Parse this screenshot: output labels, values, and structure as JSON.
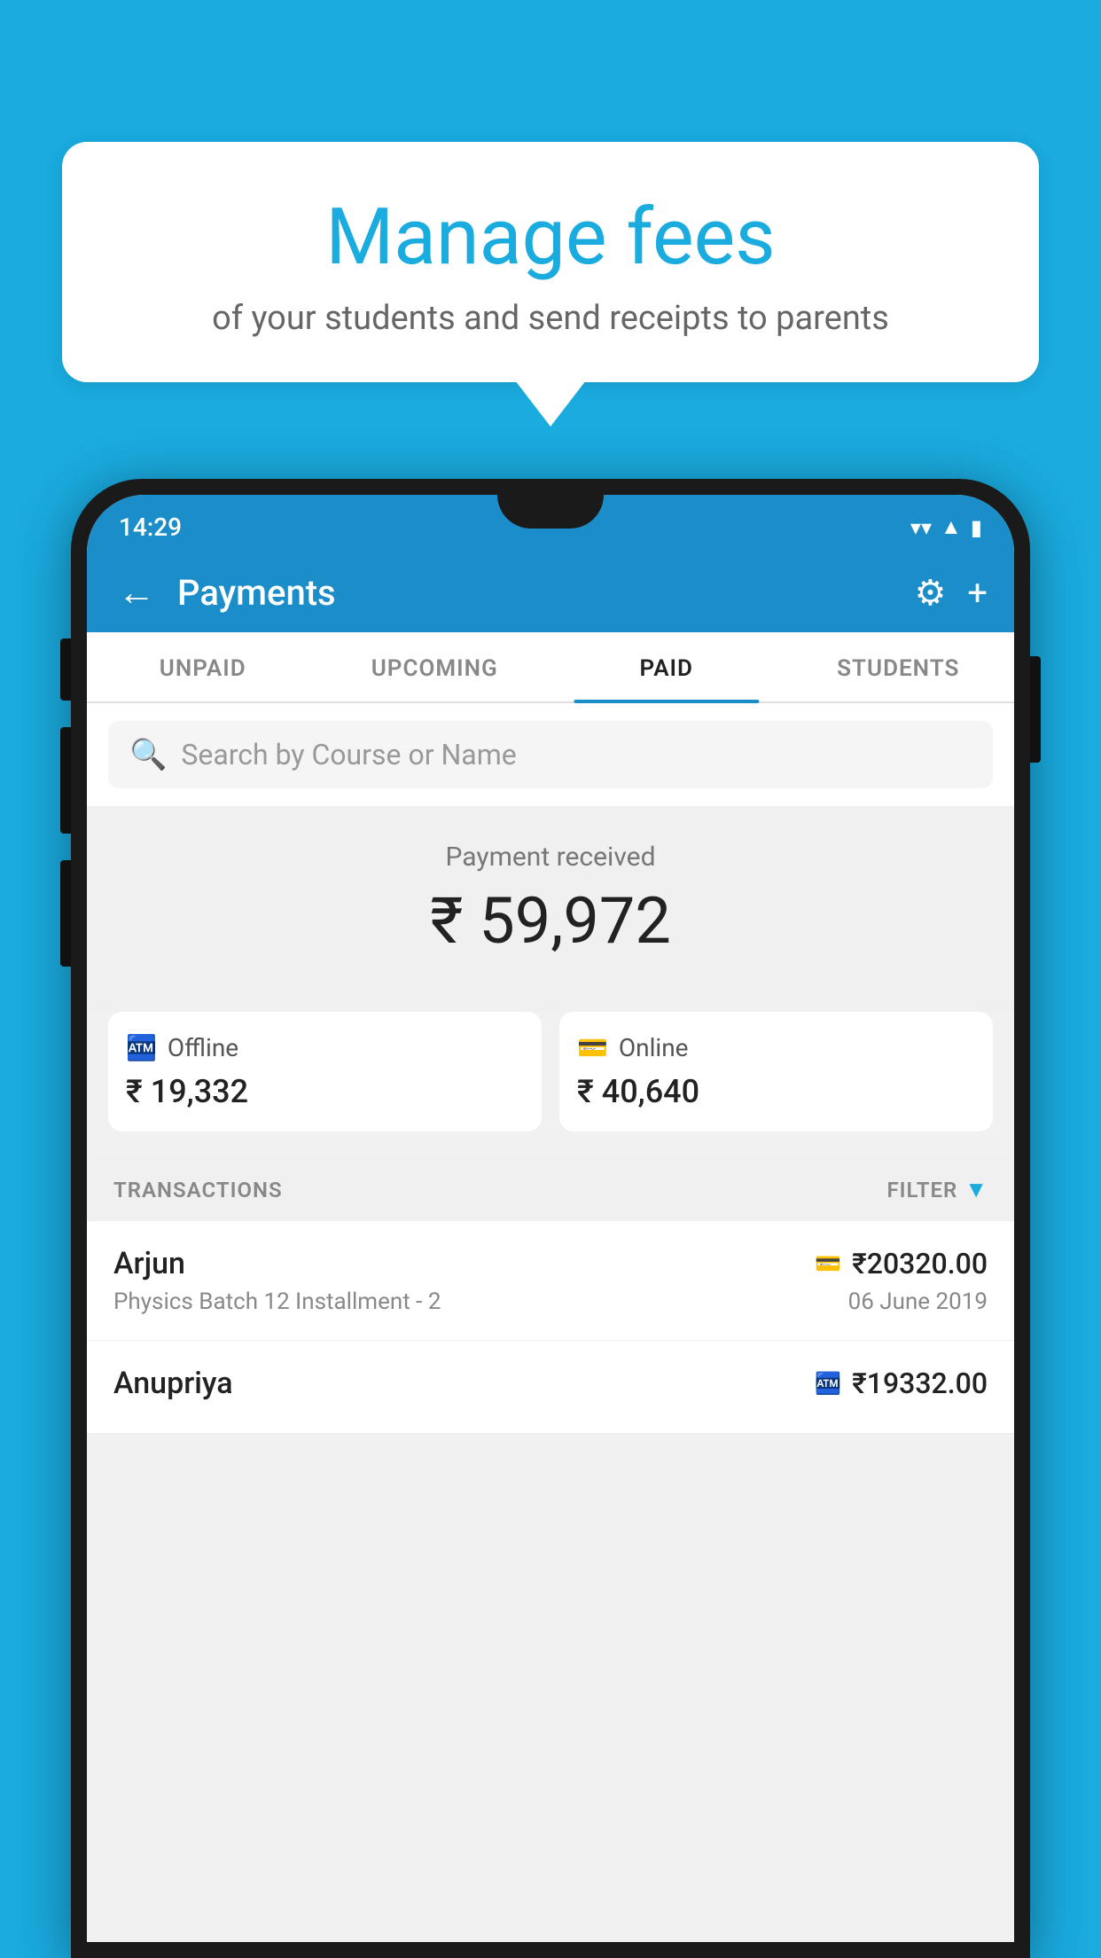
{
  "bubble": {
    "title": "Manage fees",
    "subtitle": "of your students and send receipts to parents"
  },
  "statusBar": {
    "time": "14:29",
    "wifiIcon": "▼",
    "signalIcon": "▲",
    "batteryIcon": "▮"
  },
  "header": {
    "backIcon": "←",
    "title": "Payments",
    "settingsIcon": "⚙",
    "addIcon": "+"
  },
  "tabs": [
    {
      "label": "UNPAID",
      "active": false
    },
    {
      "label": "UPCOMING",
      "active": false
    },
    {
      "label": "PAID",
      "active": true
    },
    {
      "label": "STUDENTS",
      "active": false
    }
  ],
  "search": {
    "placeholder": "Search by Course or Name",
    "searchIcon": "🔍"
  },
  "payment": {
    "receivedLabel": "Payment received",
    "totalAmount": "₹ 59,972",
    "offlineLabel": "Offline",
    "offlineAmount": "₹ 19,332",
    "onlineLabel": "Online",
    "onlineAmount": "₹ 40,640"
  },
  "transactionsHeader": {
    "label": "TRANSACTIONS",
    "filterLabel": "FILTER"
  },
  "transactions": [
    {
      "name": "Arjun",
      "paymentIcon": "💳",
      "amount": "₹20320.00",
      "course": "Physics Batch 12 Installment - 2",
      "date": "06 June 2019"
    },
    {
      "name": "Anupriya",
      "paymentIcon": "🏧",
      "amount": "₹19332.00",
      "course": "",
      "date": ""
    }
  ]
}
